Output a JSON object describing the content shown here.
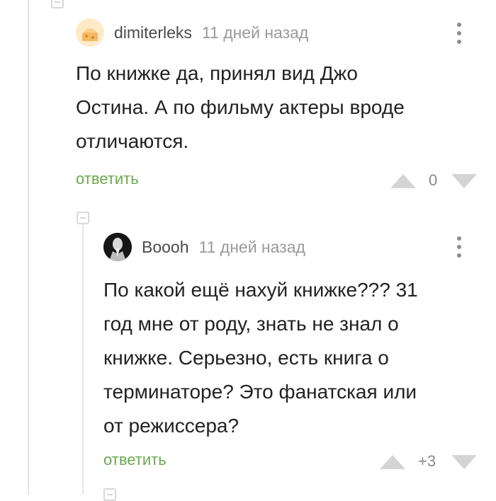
{
  "comments": [
    {
      "author": "dimiterleks",
      "time": "11 дней назад",
      "text": "По книжке да, принял вид Джо\nОстина. А по фильму актеры вроде\nотличаются.",
      "reply_label": "ответить",
      "rating": "0"
    },
    {
      "author": "Boooh",
      "time": "11 дней назад",
      "text": "По какой ещё нахуй книжке??? 31\nгод мне от роду, знать не знал о\nкнижке. Серьезно, есть книга о\nтерминаторе? Это фанатская или\nот режиссера?",
      "reply_label": "ответить",
      "rating": "+3"
    }
  ],
  "icons": {
    "menu": "vertical-dots",
    "vote_up": "triangle-up",
    "vote_down": "triangle-down",
    "collapse": "minus-box"
  },
  "colors": {
    "reply": "#6aa84f",
    "author": "#4a4a4a",
    "time": "#9a9a9a",
    "vote": "#d4d4d4"
  }
}
